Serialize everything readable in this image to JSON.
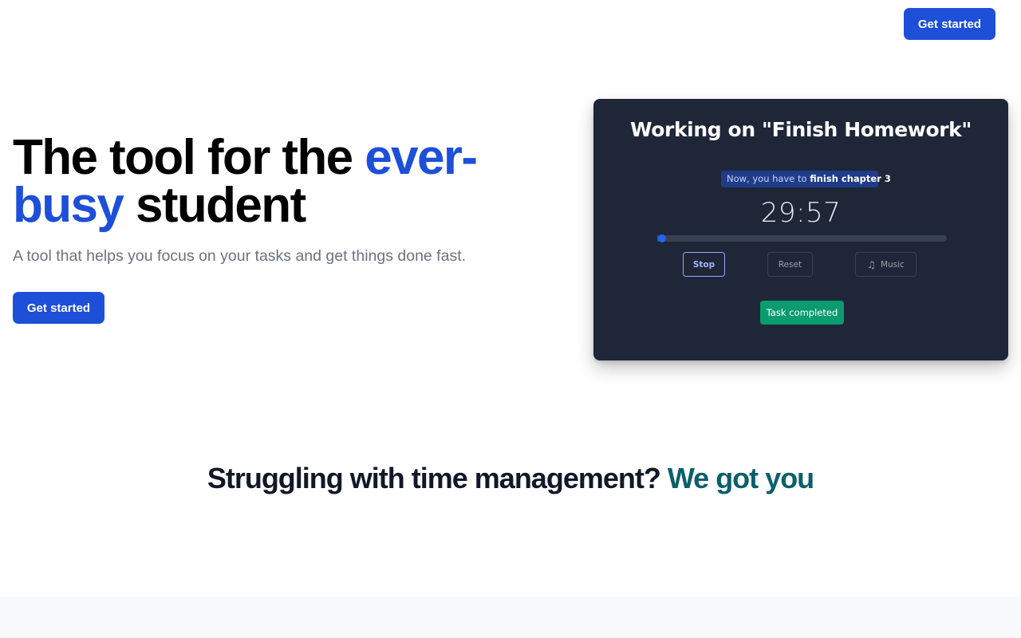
{
  "nav": {
    "cta_label": "Get started"
  },
  "hero": {
    "title_part1": "The tool for the ",
    "title_accent": "ever-busy",
    "title_part2": " student",
    "subtitle": "A tool that helps you focus on your tasks and get things done fast.",
    "cta_label": "Get started"
  },
  "timer_card": {
    "title": "Working on \"Finish Homework\"",
    "now_prefix": "Now, you have to ",
    "now_task": "finish chapter 3",
    "time": "29:57",
    "progress": 0.005,
    "stop_label": "Stop",
    "reset_label": "Reset",
    "music_icon": "music-note-icon",
    "music_label": "Music",
    "completed_label": "Task completed"
  },
  "section": {
    "title_part1": "Struggling with time management? ",
    "title_accent": "We got you"
  },
  "colors": {
    "primary": "#1d4fd8",
    "card_bg": "#1e2637",
    "success": "#0a9b6e",
    "teal_accent": "#0a5f6b",
    "muted_text": "#6b7280"
  }
}
